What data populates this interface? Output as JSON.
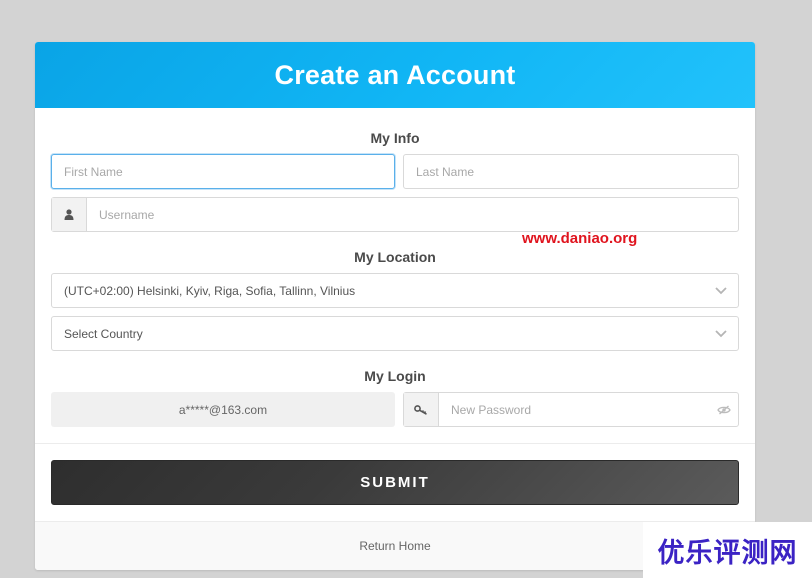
{
  "header": {
    "title": "Create an Account"
  },
  "sections": {
    "info": "My Info",
    "location": "My Location",
    "login": "My Login"
  },
  "info": {
    "first_name_placeholder": "First Name",
    "last_name_placeholder": "Last Name",
    "username_placeholder": "Username",
    "username_icon": "user-icon"
  },
  "location": {
    "timezone_selected": "(UTC+02:00) Helsinki, Kyiv, Riga, Sofia, Tallinn, Vilnius",
    "country_selected": "Select Country"
  },
  "login": {
    "email_value": "a*****@163.com",
    "password_placeholder": "New Password",
    "password_icon": "key-icon",
    "visibility_icon": "eye-slash-icon"
  },
  "submit_label": "SUBMIT",
  "footer": {
    "return_home": "Return Home"
  },
  "watermarks": {
    "url": "www.daniao.org",
    "cn": "优乐评测网"
  },
  "colors": {
    "header": "#11b6f5",
    "submit": "#3a3a3a",
    "watermark_url": "#e0141e",
    "watermark_cn": "#3b23c4"
  }
}
